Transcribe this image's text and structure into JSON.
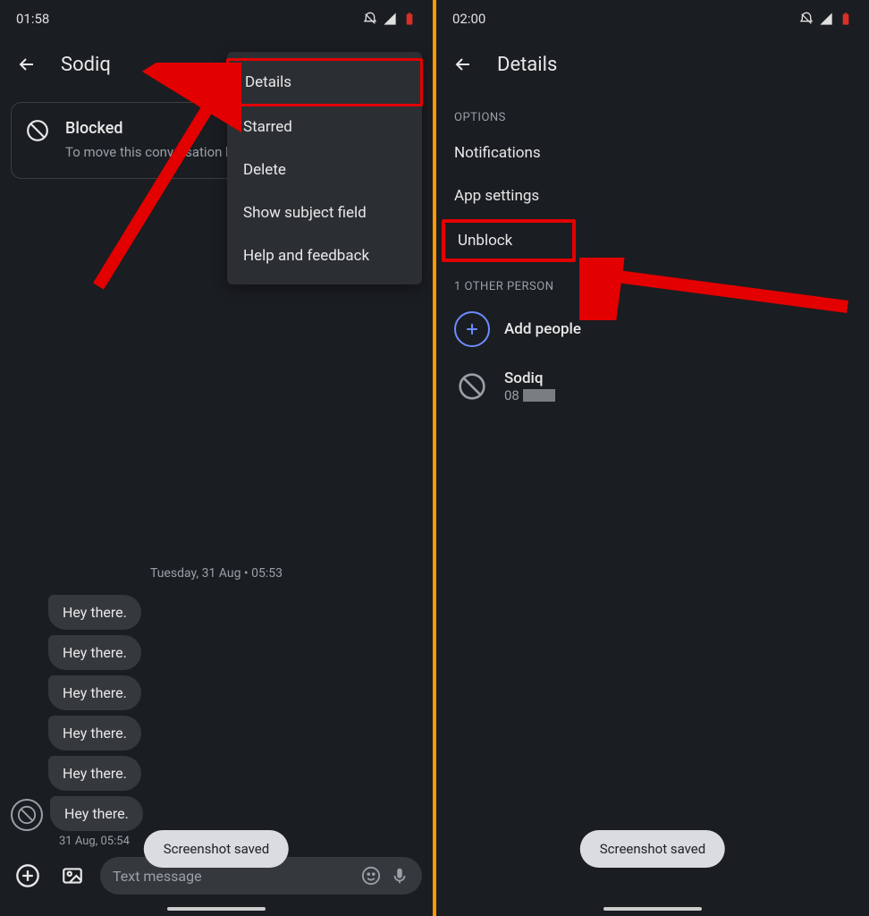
{
  "left": {
    "status": {
      "time": "01:58"
    },
    "header": {
      "contact_name": "Sodiq"
    },
    "blocked_card": {
      "title": "Blocked",
      "body": "To move this conversation blocked' and get message"
    },
    "menu": {
      "items": [
        "Details",
        "Starred",
        "Delete",
        "Show subject field",
        "Help and feedback"
      ]
    },
    "conversation": {
      "date_divider": "Tuesday, 31 Aug • 05:53",
      "messages": [
        "Hey there.",
        "Hey there.",
        "Hey there.",
        "Hey there.",
        "Hey there.",
        "Hey there."
      ],
      "timestamp": "31 Aug, 05:54"
    },
    "compose": {
      "placeholder": "Text message"
    },
    "toast": "Screenshot saved"
  },
  "right": {
    "status": {
      "time": "02:00"
    },
    "header": {
      "title": "Details"
    },
    "sections": {
      "options_label": "OPTIONS",
      "options": [
        "Notifications",
        "App settings",
        "Unblock"
      ],
      "other_person_label": "1 OTHER PERSON",
      "add_people": "Add people",
      "person": {
        "name": "Sodiq",
        "number_prefix": "08"
      }
    },
    "toast": "Screenshot saved"
  }
}
